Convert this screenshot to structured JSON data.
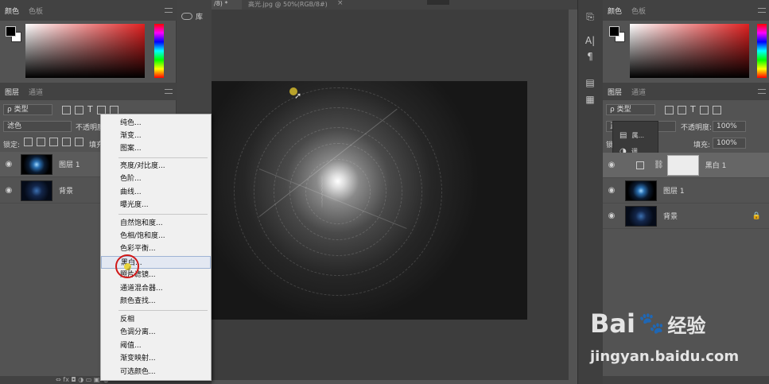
{
  "left_panel": {
    "color_tabs": [
      "颜色",
      "色板"
    ],
    "layer_tabs": [
      "图层",
      "通道"
    ],
    "filter_kind": "ρ 类型",
    "blend_mode": "滤色",
    "opacity_label": "不透明度",
    "lock_label": "锁定:",
    "fill_label": "填充",
    "layers": [
      {
        "name": "图层 1"
      },
      {
        "name": "背景"
      }
    ],
    "bottom_icons": "⇔ fx ◘ ◑ ▭ ▣ 🗑"
  },
  "library_tab": "库",
  "doc_tabs": [
    "/8) *",
    "高光.jpg @ 50%(RGB/8#)"
  ],
  "adjust_menu": {
    "items": [
      "纯色...",
      "渐变...",
      "图案...",
      "亮度/对比度...",
      "色阶...",
      "曲线...",
      "曝光度...",
      "自然饱和度...",
      "色相/饱和度...",
      "色彩平衡...",
      "黑白...",
      "照片滤镜...",
      "通道混合器...",
      "颜色查找...",
      "反相",
      "色调分离...",
      "阈值...",
      "渐变映射...",
      "可选颜色..."
    ],
    "highlighted": "黑白..."
  },
  "right_panel": {
    "color_tabs": [
      "颜色",
      "色板"
    ],
    "layer_tabs": [
      "图层",
      "通道"
    ],
    "filter_kind": "ρ 类型",
    "blend_mode": "正",
    "opacity_label": "不透明度:",
    "opacity_value": "100%",
    "lock_label": "锁",
    "fill_label": "填充:",
    "fill_value": "100%",
    "popup_items": [
      "属...",
      "调..."
    ],
    "layers": [
      {
        "name": "黑白 1"
      },
      {
        "name": "图层 1"
      },
      {
        "name": "背景"
      }
    ]
  },
  "watermark": {
    "brand": "Bai",
    "brand_suffix": "经验",
    "url": "jingyan.baidu.com"
  }
}
